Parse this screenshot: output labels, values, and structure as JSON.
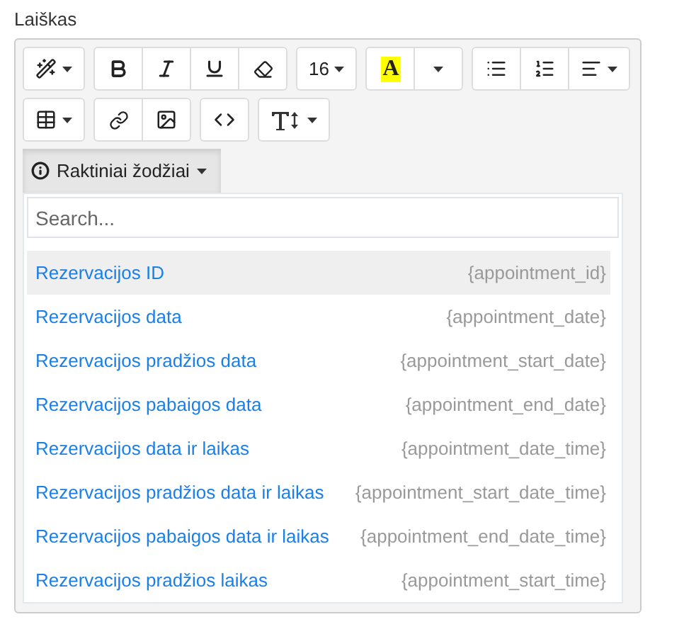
{
  "field_label": "Laiškas",
  "toolbar": [
    [
      {
        "kind": "magic"
      }
    ],
    [
      {
        "kind": "bold"
      },
      {
        "kind": "italic"
      },
      {
        "kind": "underline"
      },
      {
        "kind": "eraser"
      }
    ],
    [
      {
        "kind": "text",
        "label": "16"
      }
    ],
    [
      {
        "kind": "color",
        "label": "A",
        "color": "#ffff00"
      },
      {
        "kind": "caret"
      }
    ],
    [
      {
        "kind": "bullets"
      },
      {
        "kind": "numbers"
      },
      {
        "kind": "align"
      }
    ],
    [
      {
        "kind": "table"
      }
    ],
    [
      {
        "kind": "link"
      },
      {
        "kind": "image"
      }
    ],
    [
      {
        "kind": "code"
      }
    ],
    [
      {
        "kind": "height"
      }
    ]
  ],
  "keywords_button": {
    "label": "Raktiniai žodžiai",
    "expanded": true
  },
  "search": {
    "placeholder": "Search..."
  },
  "keywords": [
    {
      "name": "Rezervacijos ID",
      "tag": "{appointment_id}",
      "selected": true
    },
    {
      "name": "Rezervacijos data",
      "tag": "{appointment_date}",
      "selected": false
    },
    {
      "name": "Rezervacijos pradžios data",
      "tag": "{appointment_start_date}",
      "selected": false
    },
    {
      "name": "Rezervacijos pabaigos data",
      "tag": "{appointment_end_date}",
      "selected": false
    },
    {
      "name": "Rezervacijos data ir laikas",
      "tag": "{appointment_date_time}",
      "selected": false
    },
    {
      "name": "Rezervacijos pradžios data ir laikas",
      "tag": "{appointment_start_date_time}",
      "selected": false
    },
    {
      "name": "Rezervacijos pabaigos data ir laikas",
      "tag": "{appointment_end_date_time}",
      "selected": false
    },
    {
      "name": "Rezervacijos pradžios laikas",
      "tag": "{appointment_start_time}",
      "selected": false
    }
  ]
}
